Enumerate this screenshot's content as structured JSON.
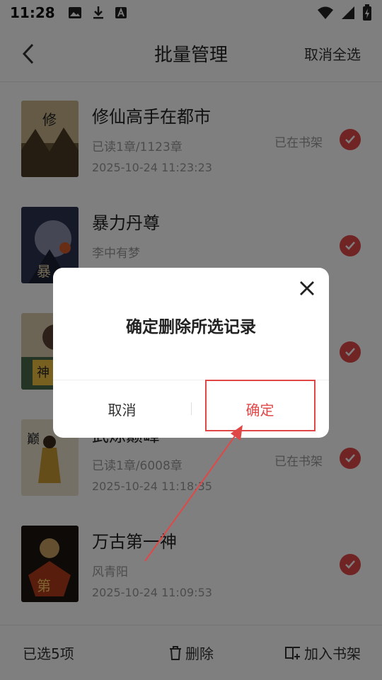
{
  "status_bar": {
    "time": "11:28"
  },
  "header": {
    "title": "批量管理",
    "cancel_all": "取消全选"
  },
  "books": [
    {
      "name": "修仙高手在都市",
      "author": "已读1章/1123章",
      "date": "2025-10-24 11:23:23",
      "shelf": "已在书架"
    },
    {
      "name": "暴力丹尊",
      "author": "李中有梦",
      "date": "",
      "shelf": ""
    },
    {
      "name": "",
      "author": "",
      "date": "",
      "shelf": ""
    },
    {
      "name": "武炼巅峰",
      "author": "已读1章/6008章",
      "date": "2025-10-24 11:18:35",
      "shelf": "已在书架"
    },
    {
      "name": "万古第一神",
      "author": "风青阳",
      "date": "2025-10-24 11:09:53",
      "shelf": ""
    }
  ],
  "bottom": {
    "selected": "已选5项",
    "delete": "删除",
    "add_shelf": "加入书架"
  },
  "dialog": {
    "message": "确定删除所选记录",
    "cancel": "取消",
    "confirm": "确定"
  },
  "colors": {
    "accent": "#e04848"
  }
}
